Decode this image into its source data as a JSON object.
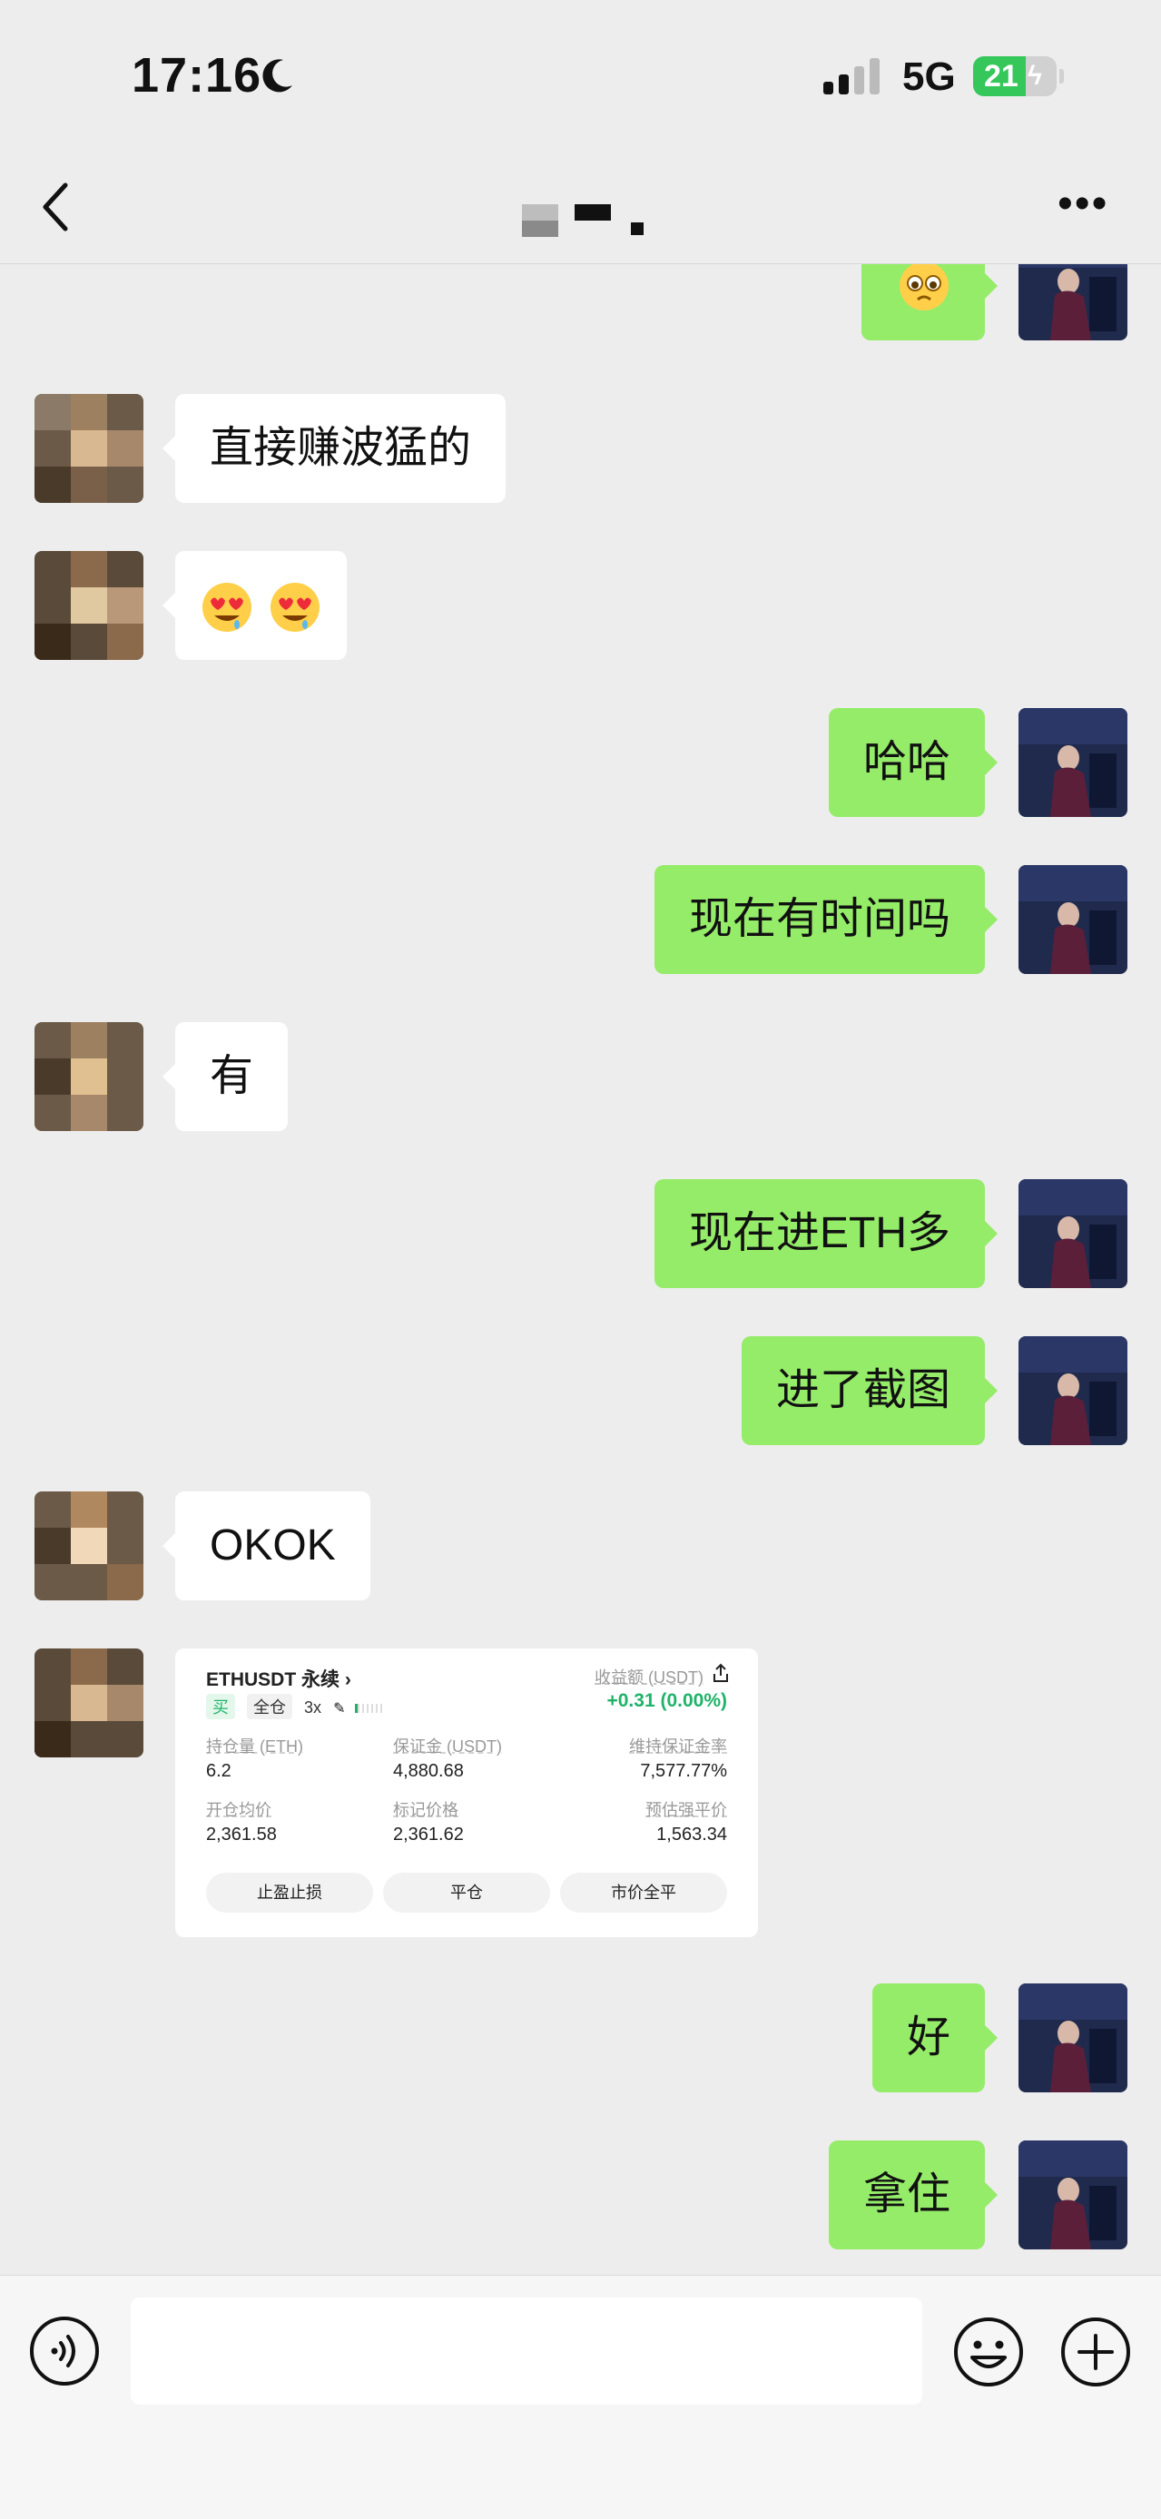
{
  "status_bar": {
    "time": "17:16",
    "network": "5G",
    "battery": "21"
  },
  "header": {
    "title_redacted": true
  },
  "messages": [
    {
      "side": "out",
      "type": "emoji",
      "emoji": "pleading-face"
    },
    {
      "side": "in",
      "type": "text",
      "text": "直接赚波猛的"
    },
    {
      "side": "in",
      "type": "emoji",
      "emoji": "heart-eyes-drool x2"
    },
    {
      "side": "out",
      "type": "text",
      "text": "哈哈"
    },
    {
      "side": "out",
      "type": "text",
      "text": "现在有时间吗"
    },
    {
      "side": "in",
      "type": "text",
      "text": "有"
    },
    {
      "side": "out",
      "type": "text",
      "text": "现在进ETH多"
    },
    {
      "side": "out",
      "type": "text",
      "text": "进了截图"
    },
    {
      "side": "in",
      "type": "text",
      "text": "OKOK"
    },
    {
      "side": "in",
      "type": "card"
    },
    {
      "side": "out",
      "type": "text",
      "text": "好"
    },
    {
      "side": "out",
      "type": "text",
      "text": "拿住"
    }
  ],
  "trade_card": {
    "symbol": "ETHUSDT 永续",
    "tag_buy": "买",
    "tag_mode": "全仓",
    "tag_leverage": "3x",
    "pnl_label": "收益额 (USDT)",
    "pnl_value": "+0.31 (0.00%)",
    "position_label": "持仓量 (ETH)",
    "position_value": "6.2",
    "margin_label": "保证金 (USDT)",
    "margin_value": "4,880.68",
    "maint_label": "维持保证金率",
    "maint_value": "7,577.77%",
    "entry_label": "开仓均价",
    "entry_value": "2,361.58",
    "mark_label": "标记价格",
    "mark_value": "2,361.62",
    "liq_label": "预估强平价",
    "liq_value": "1,563.34",
    "btn_tpsl": "止盈止损",
    "btn_close": "平仓",
    "btn_close_all": "市价全平"
  },
  "colors": {
    "out_bubble": "#95ec69",
    "in_bubble": "#ffffff",
    "background": "#ededed",
    "profit": "#1fb36a"
  }
}
